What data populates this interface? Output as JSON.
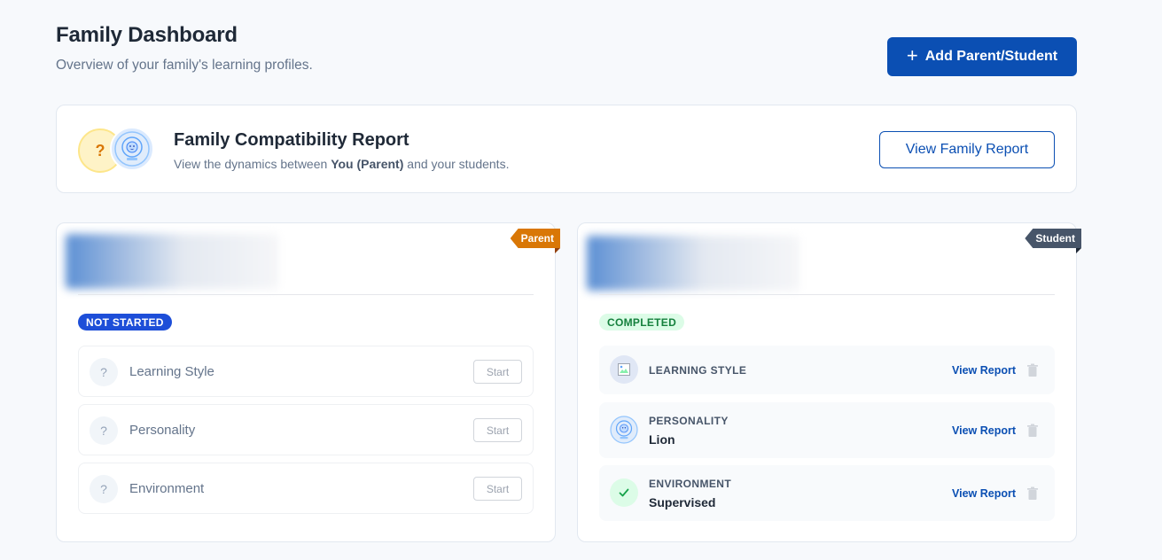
{
  "header": {
    "title": "Family Dashboard",
    "subtitle": "Overview of your family's learning profiles.",
    "add_button_label": "Add Parent/Student"
  },
  "family_report": {
    "title": "Family Compatibility Report",
    "desc_prefix": "View the dynamics between ",
    "desc_bold": "You (Parent)",
    "desc_suffix": " and your students.",
    "avatar_question": "?",
    "button_label": "View Family Report"
  },
  "parent_card": {
    "tag": "Parent",
    "status": "NOT STARTED",
    "assessments": [
      {
        "label": "Learning Style",
        "icon": "?",
        "action": "Start"
      },
      {
        "label": "Personality",
        "icon": "?",
        "action": "Start"
      },
      {
        "label": "Environment",
        "icon": "?",
        "action": "Start"
      }
    ]
  },
  "student_card": {
    "tag": "Student",
    "status": "COMPLETED",
    "assessments": [
      {
        "category": "LEARNING STYLE",
        "value": "",
        "icon": "broken-image-icon",
        "action": "View Report"
      },
      {
        "category": "PERSONALITY",
        "value": "Lion",
        "icon": "lion-badge-icon",
        "action": "View Report"
      },
      {
        "category": "ENVIRONMENT",
        "value": "Supervised",
        "icon": "check-icon",
        "action": "View Report"
      }
    ]
  },
  "colors": {
    "primary": "#0b4fb3",
    "parent_tag": "#d97706",
    "student_tag": "#475569",
    "completed_bg": "#dcfce7",
    "completed_text": "#15803d",
    "not_started_bg": "#1d4ed8"
  }
}
